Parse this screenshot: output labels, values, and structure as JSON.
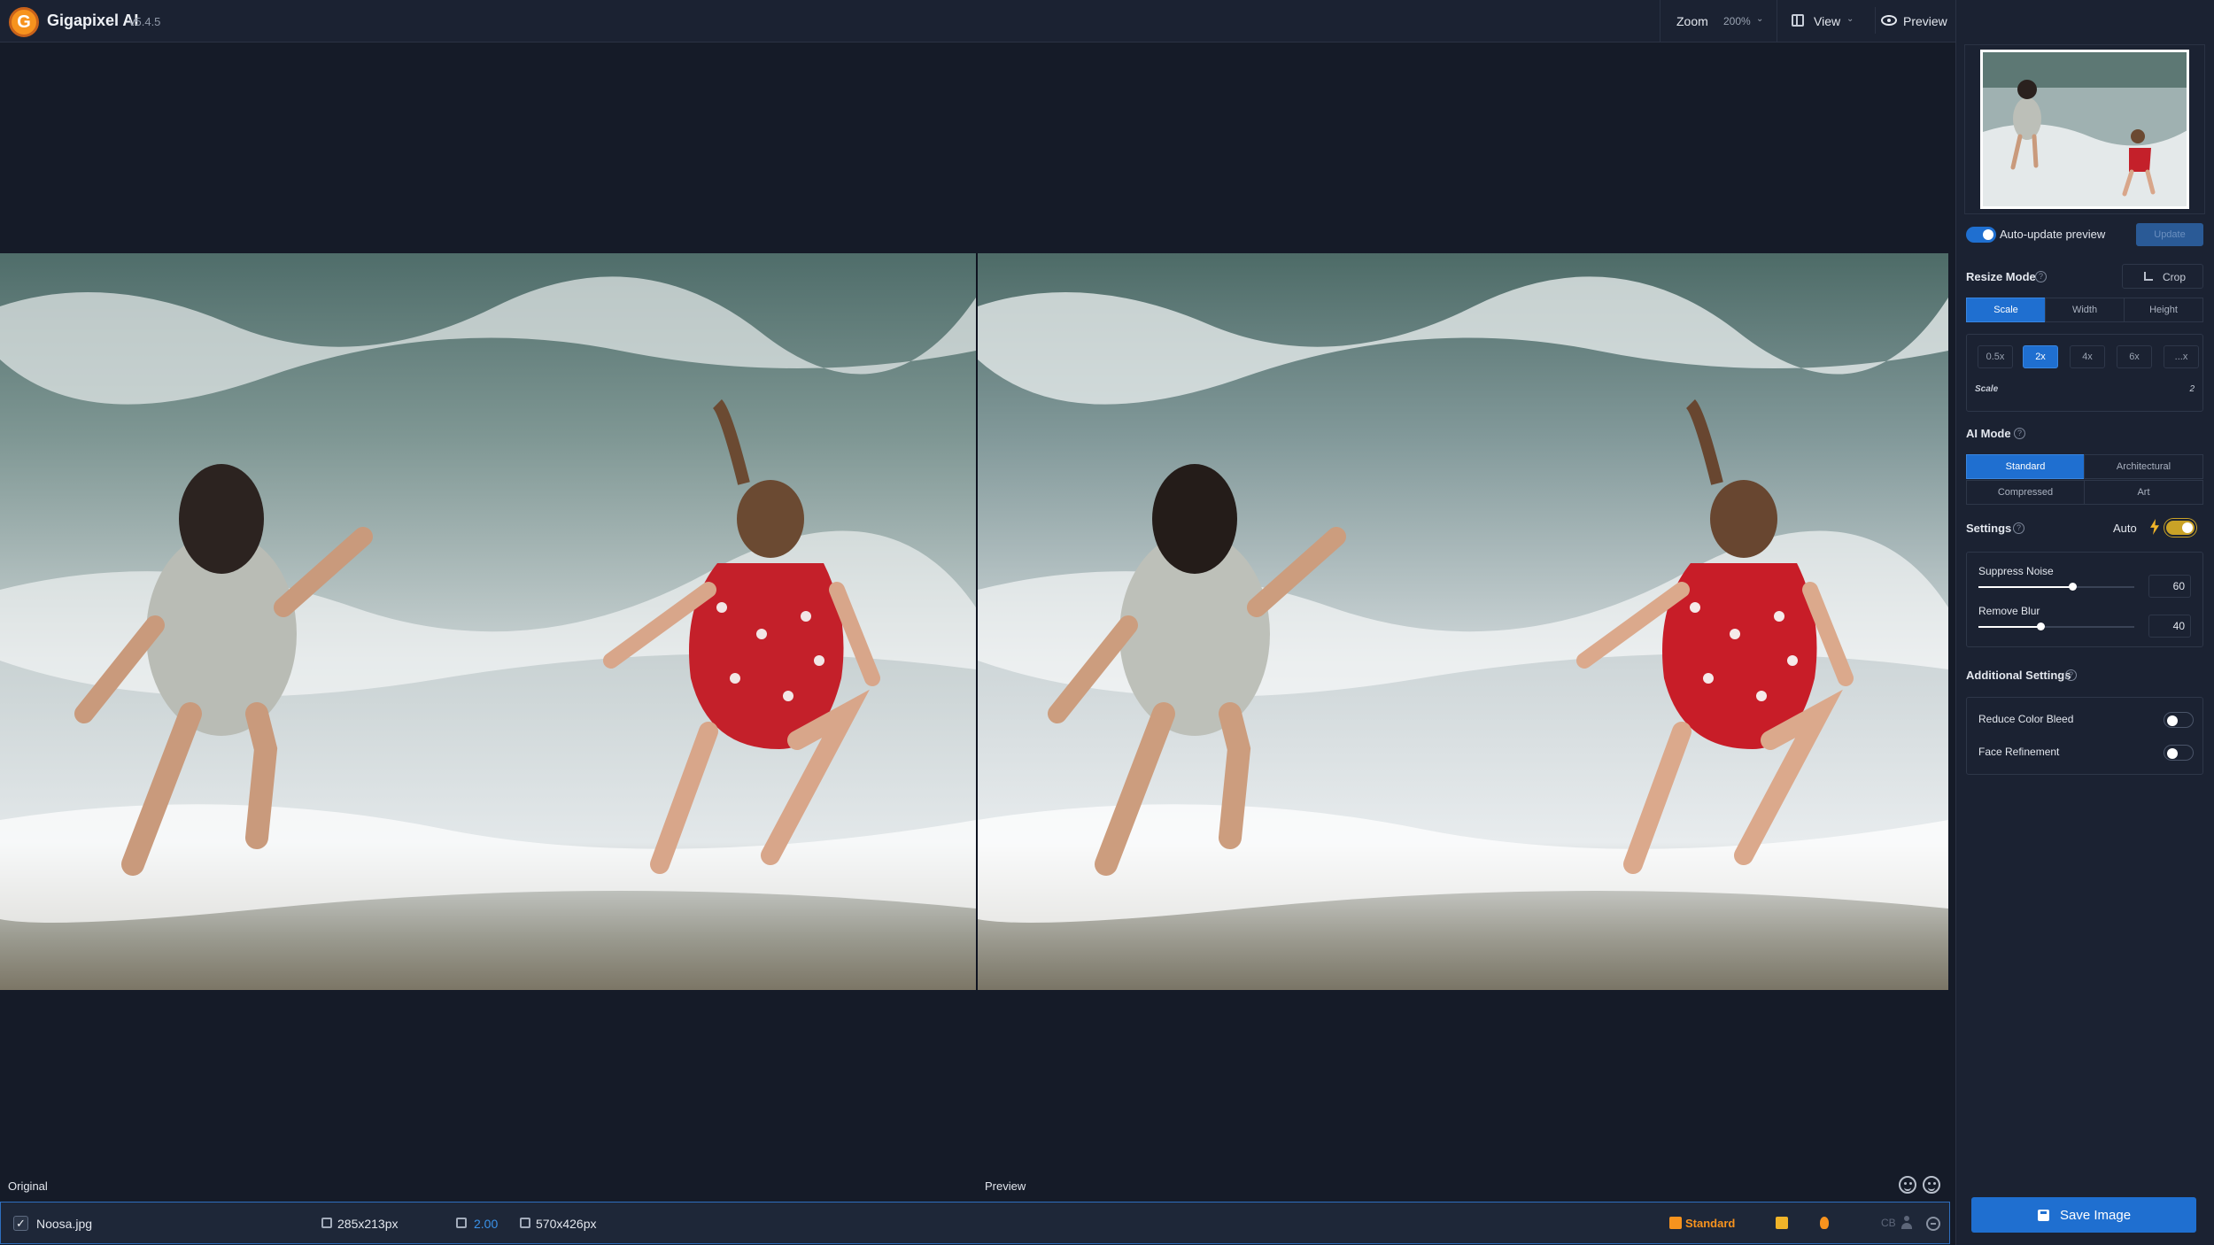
{
  "app": {
    "logo_letter": "G",
    "title": "Gigapixel AI",
    "version": "v5.4.5"
  },
  "toolbar": {
    "zoom_label": "Zoom",
    "zoom_value": "200%",
    "view_label": "View",
    "preview_label": "Preview"
  },
  "canvas": {
    "original_label": "Original",
    "preview_label": "Preview"
  },
  "file": {
    "checked": true,
    "check_mark": "✓",
    "name": "Noosa.jpg",
    "input_size": "285x213px",
    "scale": "2.00",
    "output_size": "570x426px",
    "ai_mode": "Standard",
    "cb_label": "CB"
  },
  "sidebar": {
    "auto_update_label": "Auto-update preview",
    "auto_update_on": true,
    "update_button": "Update",
    "resize_mode": {
      "title": "Resize Mode",
      "crop_label": "Crop",
      "tabs": [
        "Scale",
        "Width",
        "Height"
      ],
      "active_tab": "Scale",
      "scale_options": [
        "0.5x",
        "2x",
        "4x",
        "6x",
        "...x"
      ],
      "selected_scale": "2x",
      "scale_label": "Scale",
      "scale_value": "2"
    },
    "ai_mode": {
      "title": "AI Mode",
      "options": [
        "Standard",
        "Architectural",
        "Compressed",
        "Art"
      ],
      "selected": "Standard"
    },
    "settings": {
      "title": "Settings",
      "auto_label": "Auto",
      "auto_on": true,
      "suppress_noise": {
        "label": "Suppress Noise",
        "value": "60"
      },
      "remove_blur": {
        "label": "Remove Blur",
        "value": "40"
      }
    },
    "additional": {
      "title": "Additional Settings",
      "reduce_color_bleed": {
        "label": "Reduce Color Bleed",
        "on": false
      },
      "face_refinement": {
        "label": "Face Refinement",
        "on": false
      }
    },
    "save_button": "Save Image"
  },
  "colors": {
    "accent": "#1f6fd0",
    "brand_orange": "#f7931e",
    "auto_yellow": "#c9a227",
    "background": "#151b28",
    "panel": "#1b2232"
  }
}
